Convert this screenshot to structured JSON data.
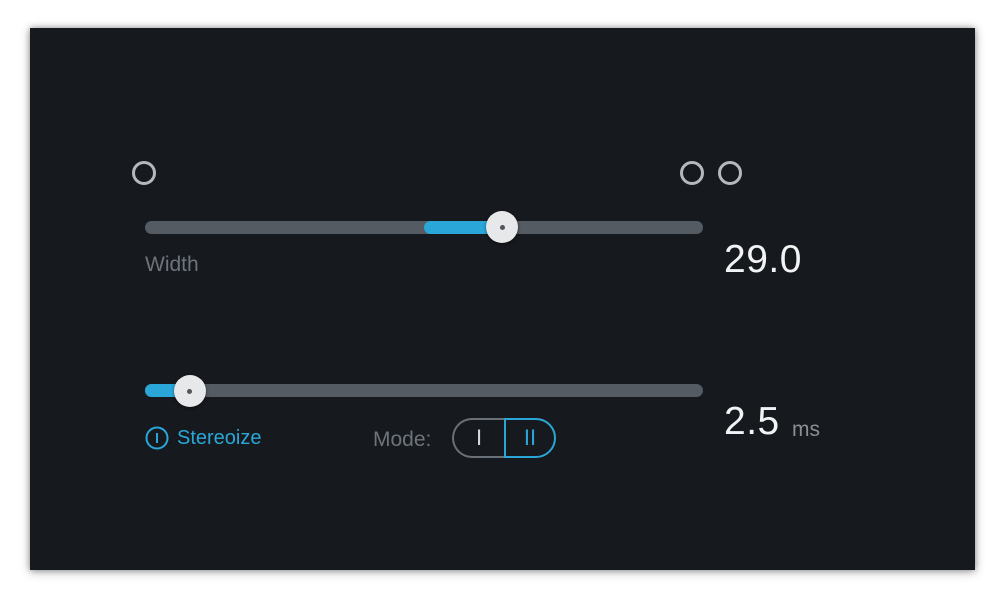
{
  "width_slider": {
    "label": "Width",
    "value": "29.0",
    "fill_start_fraction": 0.5,
    "position_fraction": 0.64
  },
  "delay_slider": {
    "value": "2.5",
    "unit": "ms",
    "position_fraction": 0.08
  },
  "stereoize": {
    "label": "Stereoize",
    "enabled": true
  },
  "mode": {
    "label": "Mode:",
    "options": [
      "I",
      "II"
    ],
    "selected": "II"
  },
  "colors": {
    "accent": "#2aa7d8",
    "panel": "#16191d",
    "track": "#545b63"
  },
  "icons": {
    "mono": "circle-outline-icon",
    "stereo": "double-circle-outline-icon",
    "stereoize": "power-icon"
  }
}
